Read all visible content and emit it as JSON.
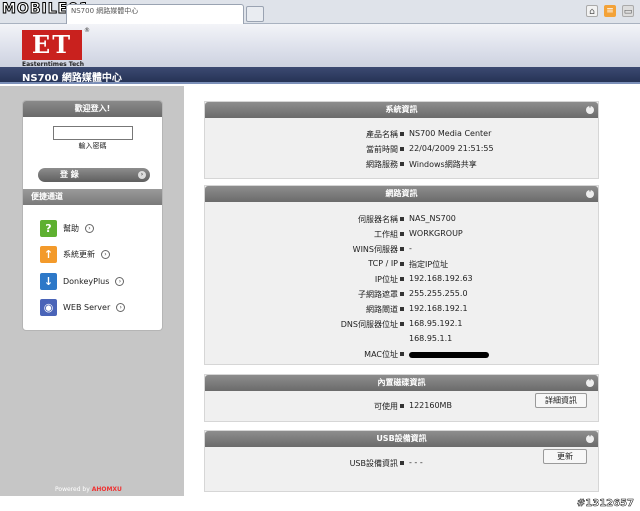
{
  "browser": {
    "watermark": "MOBILE01",
    "tab_title": "NS700 網路媒體中心"
  },
  "header": {
    "logo_text": "ET",
    "logo_sub": "Easterntimes Tech",
    "title": "NS700 網路媒體中心"
  },
  "login": {
    "heading": "歡迎登入!",
    "password_label": "輸入密碼",
    "login_button": "登 錄"
  },
  "shortcuts": {
    "heading": "便捷通道",
    "items": [
      {
        "label": "幫助"
      },
      {
        "label": "系統更新"
      },
      {
        "label": "DonkeyPlus"
      },
      {
        "label": "WEB Server"
      }
    ]
  },
  "footer": {
    "powered_prefix": "Powered by ",
    "powered_brand": "AHOMXU"
  },
  "system_info": {
    "heading": "系統資訊",
    "rows": [
      {
        "label": "產品名稱",
        "value": "NS700 Media Center"
      },
      {
        "label": "當前時間",
        "value": "22/04/2009 21:51:55"
      },
      {
        "label": "網路服務",
        "value": "Windows網路共享"
      }
    ]
  },
  "network_info": {
    "heading": "網路資訊",
    "rows": [
      {
        "label": "伺服器名稱",
        "value": "NAS_NS700"
      },
      {
        "label": "工作組",
        "value": "WORKGROUP"
      },
      {
        "label": "WINS伺服器",
        "value": "-"
      },
      {
        "label": "TCP / IP",
        "value": "指定IP位址"
      },
      {
        "label": "IP位址",
        "value": "192.168.192.63"
      },
      {
        "label": "子網路遮罩",
        "value": "255.255.255.0"
      },
      {
        "label": "網路閘道",
        "value": "192.168.192.1"
      },
      {
        "label": "DNS伺服器位址",
        "value": "168.95.192.1"
      },
      {
        "label": "",
        "value": "168.95.1.1"
      },
      {
        "label": "MAC位址",
        "value": ""
      }
    ]
  },
  "disk_info": {
    "heading": "內置磁碟資訊",
    "available_label": "可使用",
    "available_value": "122160MB",
    "detail_button": "詳細資訊"
  },
  "usb_info": {
    "heading": "USB設備資訊",
    "label": "USB設備資訊",
    "value": "-    -    -",
    "refresh_button": "更新"
  },
  "watermark_id": "#1312657"
}
